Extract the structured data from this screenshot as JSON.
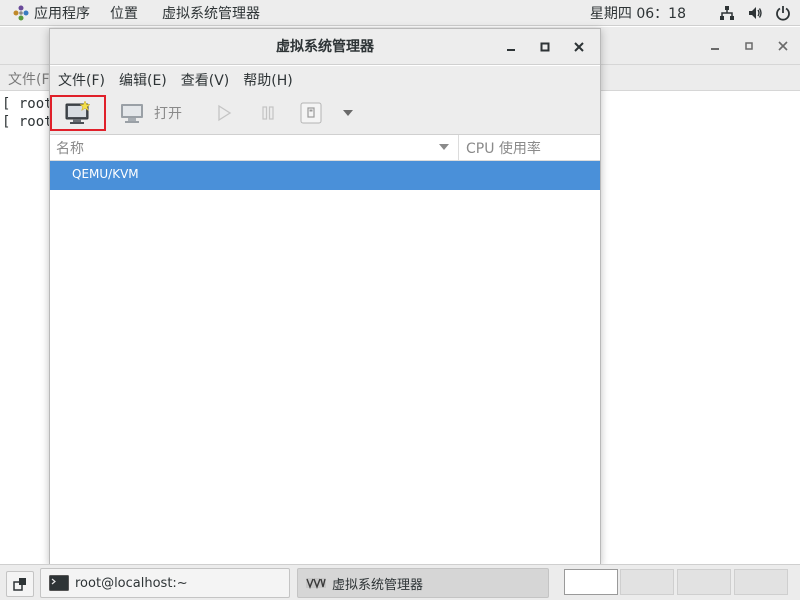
{
  "top_panel": {
    "applications": "应用程序",
    "places": "位置",
    "active_app": "虚拟系统管理器",
    "clock": "星期四 06：18"
  },
  "bg_terminal": {
    "menu_fragment": "文件(F",
    "lines": [
      "[ root@",
      "[ root@"
    ]
  },
  "window": {
    "title": "虚拟系统管理器",
    "menu": {
      "file": "文件(F)",
      "edit": "编辑(E)",
      "view": "查看(V)",
      "help": "帮助(H)"
    },
    "toolbar": {
      "open_label": "打开"
    },
    "columns": {
      "name": "名称",
      "cpu": "CPU 使用率"
    },
    "connections": [
      {
        "label": "QEMU/KVM",
        "selected": true
      }
    ]
  },
  "taskbar": {
    "tasks": [
      {
        "label": "root@localhost:~"
      },
      {
        "label": "虚拟系统管理器"
      }
    ],
    "workspaces": 4
  },
  "colors": {
    "selection": "#4a90d9",
    "highlight_border": "#e0202a",
    "panel_bg": "#ededed"
  }
}
